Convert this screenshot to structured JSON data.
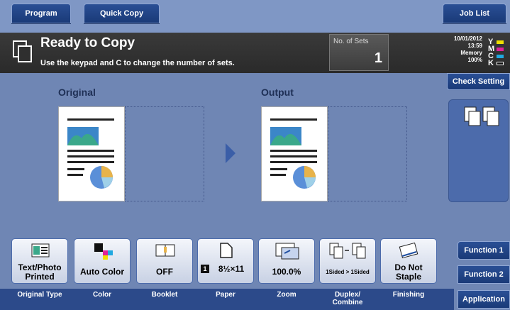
{
  "tabs": {
    "program": "Program",
    "quick_copy": "Quick Copy",
    "job_list": "Job List"
  },
  "message": {
    "title": "Ready to Copy",
    "hint": "Use the keypad and C to change the number of sets."
  },
  "sets": {
    "label": "No. of Sets",
    "value": "1"
  },
  "status": {
    "date": "10/01/2012",
    "time": "13:59",
    "memory_label": "Memory",
    "memory_value": "100%",
    "toner": [
      "Y",
      "M",
      "C",
      "K"
    ]
  },
  "check_setting": "Check Setting",
  "panels": {
    "original": "Original",
    "output": "Output"
  },
  "functions": [
    {
      "label": "Text/Photo\nPrinted",
      "caption": "Original Type"
    },
    {
      "label": "Auto Color",
      "caption": "Color"
    },
    {
      "label": "OFF",
      "caption": "Booklet"
    },
    {
      "label": "8½×11",
      "tray": "1",
      "caption": "Paper"
    },
    {
      "label": "100.0%",
      "caption": "Zoom"
    },
    {
      "label": "1Sided > 1Sided",
      "caption": "Duplex/\nCombine"
    },
    {
      "label": "Do Not\nStaple",
      "caption": "Finishing"
    }
  ],
  "side_menu": {
    "function1": "Function 1",
    "function2": "Function 2",
    "application": "Application"
  },
  "colors": {
    "accent": "#2a4f95",
    "background": "#6f86b4",
    "message_bar": "#2f2f2f"
  }
}
